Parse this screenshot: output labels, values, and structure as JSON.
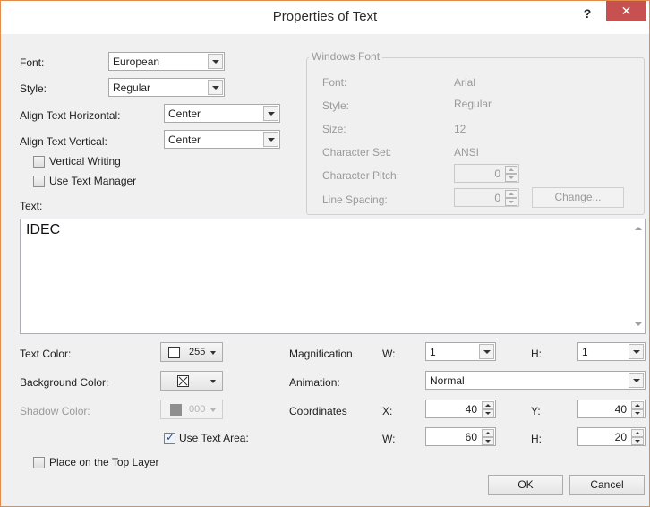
{
  "window": {
    "title": "Properties of Text",
    "help": "?",
    "close": "✕"
  },
  "left": {
    "font_label": "Font:",
    "font_value": "European",
    "style_label": "Style:",
    "style_value": "Regular",
    "align_h_label": "Align Text Horizontal:",
    "align_h_value": "Center",
    "align_v_label": "Align Text Vertical:",
    "align_v_value": "Center",
    "vertical_writing_label": "Vertical Writing",
    "vertical_writing_checked": false,
    "use_text_manager_label": "Use Text Manager",
    "use_text_manager_checked": false,
    "text_label": "Text:",
    "text_value": "IDEC"
  },
  "windows_font": {
    "group_title": "Windows Font",
    "font_label": "Font:",
    "font_value": "Arial",
    "style_label": "Style:",
    "style_value": "Regular",
    "size_label": "Size:",
    "size_value": "12",
    "charset_label": "Character Set:",
    "charset_value": "ANSI",
    "pitch_label": "Character Pitch:",
    "pitch_value": "0",
    "spacing_label": "Line Spacing:",
    "spacing_value": "0",
    "change_button": "Change..."
  },
  "colors": {
    "text_color_label": "Text Color:",
    "text_color_value": "255",
    "background_color_label": "Background Color:",
    "shadow_color_label": "Shadow Color:",
    "shadow_color_value": "000",
    "use_text_area_label": "Use Text Area:",
    "use_text_area_checked": true,
    "top_layer_label": "Place on the Top Layer",
    "top_layer_checked": false
  },
  "right": {
    "magnification_label": "Magnification",
    "mag_w_label": "W:",
    "mag_w_value": "1",
    "mag_h_label": "H:",
    "mag_h_value": "1",
    "animation_label": "Animation:",
    "animation_value": "Normal",
    "coordinates_label": "Coordinates",
    "x_label": "X:",
    "x_value": "40",
    "y_label": "Y:",
    "y_value": "40",
    "w_label": "W:",
    "w_value": "60",
    "h_label": "H:",
    "h_value": "20"
  },
  "buttons": {
    "ok": "OK",
    "cancel": "Cancel"
  }
}
